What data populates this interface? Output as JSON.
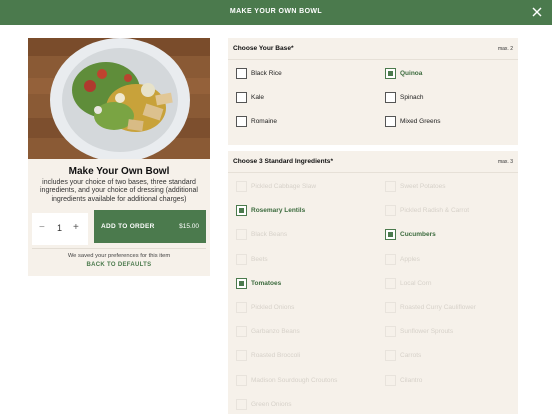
{
  "header": {
    "title": "MAKE YOUR OWN BOWL"
  },
  "item": {
    "name": "Make Your Own Bowl",
    "description": "includes your choice of two bases, three standard ingredients, and your choice of dressing (additional ingredients available for additional charges)",
    "quantity": "1",
    "add_label": "ADD TO ORDER",
    "price": "$15.00",
    "saved_text": "We saved your preferences for this item",
    "reset_label": "BACK TO DEFAULTS"
  },
  "base": {
    "title": "Choose Your Base*",
    "max": "max. 2",
    "options": [
      {
        "label": "Black Rice",
        "checked": false,
        "dim": false
      },
      {
        "label": "Quinoa",
        "checked": true,
        "dim": false
      },
      {
        "label": "Kale",
        "checked": false,
        "dim": false
      },
      {
        "label": "Spinach",
        "checked": false,
        "dim": false
      },
      {
        "label": "Romaine",
        "checked": false,
        "dim": false
      },
      {
        "label": "Mixed Greens",
        "checked": false,
        "dim": false
      }
    ]
  },
  "ingredients": {
    "title": "Choose 3 Standard Ingredients*",
    "max": "max. 3",
    "options": [
      {
        "label": "Pickled Cabbage Slaw",
        "checked": false,
        "dim": true
      },
      {
        "label": "Sweet Potatoes",
        "checked": false,
        "dim": true
      },
      {
        "label": "Rosemary Lentils",
        "checked": true,
        "dim": false
      },
      {
        "label": "Pickled Radish & Carrot",
        "checked": false,
        "dim": true
      },
      {
        "label": "Black Beans",
        "checked": false,
        "dim": true
      },
      {
        "label": "Cucumbers",
        "checked": true,
        "dim": false
      },
      {
        "label": "Beets",
        "checked": false,
        "dim": true
      },
      {
        "label": "Apples",
        "checked": false,
        "dim": true
      },
      {
        "label": "Tomatoes",
        "checked": true,
        "dim": false
      },
      {
        "label": "Local Corn",
        "checked": false,
        "dim": true
      },
      {
        "label": "Pickled Onions",
        "checked": false,
        "dim": true
      },
      {
        "label": "Roasted Curry Cauliflower",
        "checked": false,
        "dim": true
      },
      {
        "label": "Garbanzo Beans",
        "checked": false,
        "dim": true
      },
      {
        "label": "Sunflower Sprouts",
        "checked": false,
        "dim": true
      },
      {
        "label": "Roasted Broccoli",
        "checked": false,
        "dim": true
      },
      {
        "label": "Carrots",
        "checked": false,
        "dim": true
      },
      {
        "label": "Madison Sourdough Croutons",
        "checked": false,
        "dim": true
      },
      {
        "label": "Cilantro",
        "checked": false,
        "dim": true
      },
      {
        "label": "Green Onions",
        "checked": false,
        "dim": true
      }
    ]
  },
  "colors": {
    "brand": "#4b7a4d",
    "panel": "#f6f1ea"
  }
}
